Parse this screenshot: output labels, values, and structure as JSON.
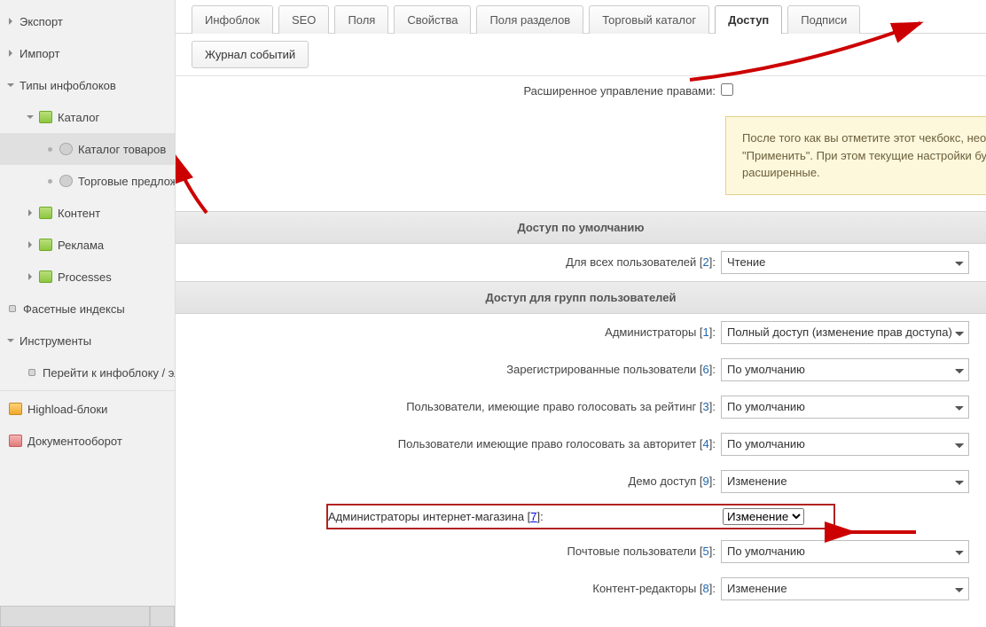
{
  "sidebar": {
    "items": [
      {
        "label": "Экспорт"
      },
      {
        "label": "Импорт"
      },
      {
        "label": "Типы инфоблоков"
      },
      {
        "label": "Каталог"
      },
      {
        "label": "Каталог товаров"
      },
      {
        "label": "Торговые предложения"
      },
      {
        "label": "Контент"
      },
      {
        "label": "Реклама"
      },
      {
        "label": "Processes"
      },
      {
        "label": "Фасетные индексы"
      },
      {
        "label": "Инструменты"
      },
      {
        "label": "Перейти к инфоблоку / элементу"
      },
      {
        "label": "Highload-блоки"
      },
      {
        "label": "Документооборот"
      }
    ]
  },
  "tabs": {
    "row1": [
      "Инфоблок",
      "SEO",
      "Поля",
      "Свойства",
      "Поля разделов",
      "Торговый каталог",
      "Доступ",
      "Подписи"
    ],
    "row2": [
      "Журнал событий"
    ],
    "active": "Доступ"
  },
  "form": {
    "ext_label": "Расширенное управление правами:",
    "notice": "После того как вы отметите этот чекбокс, необходимо нажать кнопку \"Применить\". При этом текущие настройки будут сконвертированы в расширенные.",
    "section1": "Доступ по умолчанию",
    "section2": "Доступ для групп пользователей",
    "default_row": {
      "label": "Для всех пользователей",
      "num": "2",
      "value": "Чтение"
    },
    "groups": [
      {
        "label": "Администраторы",
        "num": "1",
        "value": "Полный доступ (изменение прав доступа)"
      },
      {
        "label": "Зарегистрированные пользователи",
        "num": "6",
        "value": "По умолчанию"
      },
      {
        "label": "Пользователи, имеющие право голосовать за рейтинг",
        "num": "3",
        "value": "По умолчанию"
      },
      {
        "label": "Пользователи имеющие право голосовать за авторитет",
        "num": "4",
        "value": "По умолчанию"
      },
      {
        "label": "Демо доступ",
        "num": "9",
        "value": "Изменение"
      },
      {
        "label": "Администраторы интернет-магазина",
        "num": "7",
        "value": "Изменение",
        "highlight": true
      },
      {
        "label": "Почтовые пользователи",
        "num": "5",
        "value": "По умолчанию"
      },
      {
        "label": "Контент-редакторы",
        "num": "8",
        "value": "Изменение"
      }
    ]
  }
}
